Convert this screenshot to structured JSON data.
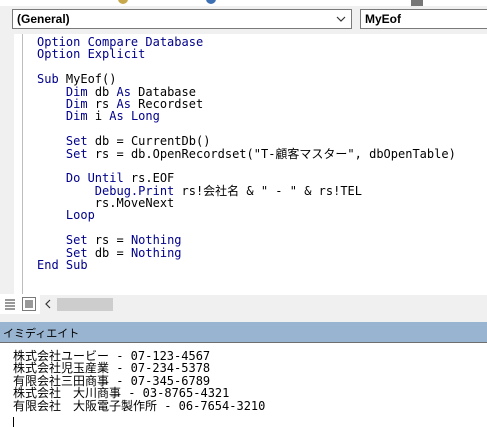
{
  "toolbar": {
    "object_combo_value": "(General)",
    "procedure_combo_value": "MyEof"
  },
  "code": {
    "lines": [
      [
        {
          "t": "Option Compare Database",
          "kw": true
        }
      ],
      [
        {
          "t": "Option Explicit",
          "kw": true
        }
      ],
      [
        {
          "t": "",
          "kw": false
        }
      ],
      [
        {
          "t": "Sub",
          "kw": true
        },
        {
          "t": " MyEof()",
          "kw": false
        }
      ],
      [
        {
          "t": "    ",
          "kw": false
        },
        {
          "t": "Dim",
          "kw": true
        },
        {
          "t": " db ",
          "kw": false
        },
        {
          "t": "As",
          "kw": true
        },
        {
          "t": " Database",
          "kw": false
        }
      ],
      [
        {
          "t": "    ",
          "kw": false
        },
        {
          "t": "Dim",
          "kw": true
        },
        {
          "t": " rs ",
          "kw": false
        },
        {
          "t": "As",
          "kw": true
        },
        {
          "t": " Recordset",
          "kw": false
        }
      ],
      [
        {
          "t": "    ",
          "kw": false
        },
        {
          "t": "Dim",
          "kw": true
        },
        {
          "t": " i ",
          "kw": false
        },
        {
          "t": "As Long",
          "kw": true
        }
      ],
      [
        {
          "t": "",
          "kw": false
        }
      ],
      [
        {
          "t": "    ",
          "kw": false
        },
        {
          "t": "Set",
          "kw": true
        },
        {
          "t": " db = CurrentDb()",
          "kw": false
        }
      ],
      [
        {
          "t": "    ",
          "kw": false
        },
        {
          "t": "Set",
          "kw": true
        },
        {
          "t": " rs = db.OpenRecordset(\"T-顧客マスター\", dbOpenTable)",
          "kw": false
        }
      ],
      [
        {
          "t": "",
          "kw": false
        }
      ],
      [
        {
          "t": "    ",
          "kw": false
        },
        {
          "t": "Do Until",
          "kw": true
        },
        {
          "t": " rs.EOF",
          "kw": false
        }
      ],
      [
        {
          "t": "        ",
          "kw": false
        },
        {
          "t": "Debug.Print",
          "kw": true
        },
        {
          "t": " rs!会社名 & \" - \" & rs!TEL",
          "kw": false
        }
      ],
      [
        {
          "t": "        rs.MoveNext",
          "kw": false
        }
      ],
      [
        {
          "t": "    ",
          "kw": false
        },
        {
          "t": "Loop",
          "kw": true
        }
      ],
      [
        {
          "t": "",
          "kw": false
        }
      ],
      [
        {
          "t": "    ",
          "kw": false
        },
        {
          "t": "Set",
          "kw": true
        },
        {
          "t": " rs = ",
          "kw": false
        },
        {
          "t": "Nothing",
          "kw": true
        }
      ],
      [
        {
          "t": "    ",
          "kw": false
        },
        {
          "t": "Set",
          "kw": true
        },
        {
          "t": " db = ",
          "kw": false
        },
        {
          "t": "Nothing",
          "kw": true
        }
      ],
      [
        {
          "t": "End Sub",
          "kw": true
        }
      ]
    ]
  },
  "immediate": {
    "title": "イミディエイト",
    "output": [
      "株式会社ユービー - 07-123-4567",
      "株式会社児玉産業 - 07-234-5378",
      "有限会社三田商事 - 07-345-6789",
      "株式会社　大川商事 - 03-8765-4321",
      "有限会社　大阪電子製作所 - 06-7654-3210"
    ]
  },
  "icons": {
    "object_combo_dropdown": "chevron-down-icon",
    "procedure_view": "procedure-view-icon",
    "full_module_view": "full-module-view-icon",
    "scroll_left": "chevron-left-icon"
  },
  "colors": {
    "keyword": "#00008b",
    "text": "#000000",
    "immediate_title_bg": "#99b4d1"
  }
}
